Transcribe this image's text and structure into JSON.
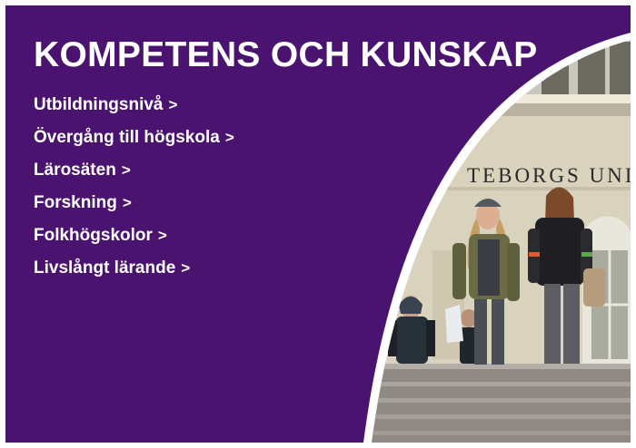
{
  "page": {
    "title": "KOMPETENS OCH KUNSKAP",
    "links": [
      {
        "label": "Utbildningsnivå"
      },
      {
        "label": "Övergång till högskola"
      },
      {
        "label": "Lärosäten"
      },
      {
        "label": "Forskning"
      },
      {
        "label": "Folkhögskolor"
      },
      {
        "label": "Livslångt lärande"
      }
    ],
    "link_arrow": ">",
    "photo": {
      "building_sign": "TEBORGS UNI"
    }
  },
  "colors": {
    "panel": "#4b1370",
    "text": "#ffffff",
    "wall": "#d9d2bd"
  }
}
